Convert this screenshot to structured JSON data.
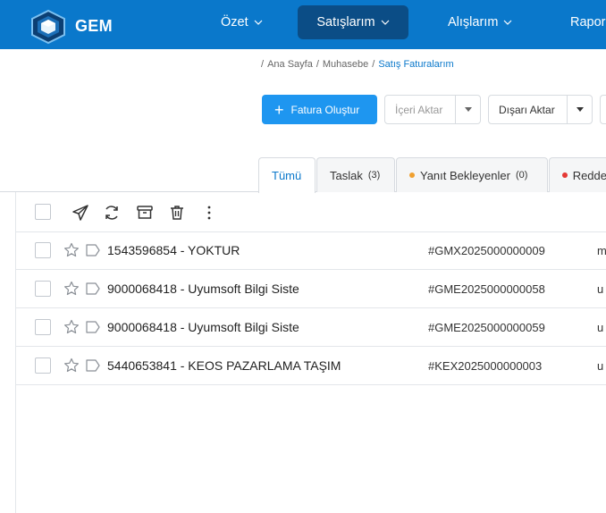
{
  "brand": {
    "name": "GEM"
  },
  "nav": [
    {
      "label": "Özet",
      "active": false
    },
    {
      "label": "Satışlarım",
      "active": true
    },
    {
      "label": "Alışlarım",
      "active": false
    },
    {
      "label": "Raporl",
      "active": false
    }
  ],
  "breadcrumb": {
    "items": [
      "Ana Sayfa",
      "Muhasebe"
    ],
    "current": "Satış Faturalarım"
  },
  "toolbar": {
    "create_label": "Fatura Oluştur",
    "import_label": "İçeri Aktar",
    "export_label": "Dışarı Aktar"
  },
  "tabs": [
    {
      "label": "Tümü",
      "count": ""
    },
    {
      "label": "Taslak",
      "count": "(3)"
    },
    {
      "label": "Yanıt Bekleyenler",
      "count": "(0)"
    },
    {
      "label": "Redde",
      "count": ""
    }
  ],
  "colors": {
    "accent": "#0a78cb",
    "primary_button": "#1e96f0",
    "pending_dot": "#f0a030",
    "rejected_dot": "#e53935"
  },
  "rows": [
    {
      "title": "1543596854 - YOKTUR",
      "invoice_no": "#GMX2025000000009",
      "extra": "m"
    },
    {
      "title": "9000068418 - Uyumsoft Bilgi Siste",
      "invoice_no": "#GME2025000000058",
      "extra": "u"
    },
    {
      "title": "9000068418 - Uyumsoft Bilgi Siste",
      "invoice_no": "#GME2025000000059",
      "extra": "u"
    },
    {
      "title": "5440653841 - KEOS PAZARLAMA TAŞIM",
      "invoice_no": "#KEX2025000000003",
      "extra": "u"
    }
  ]
}
